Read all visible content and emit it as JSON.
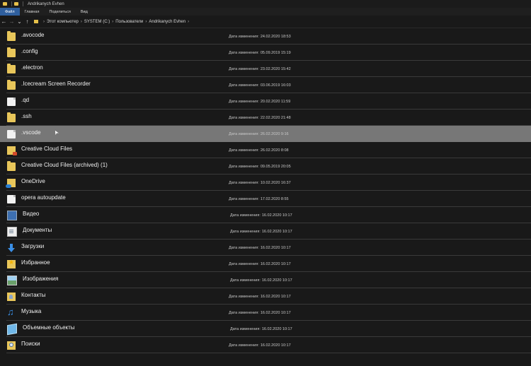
{
  "window": {
    "title": "Andrikanych Evhen"
  },
  "ribbon": {
    "tabs": [
      "Файл",
      "Главная",
      "Поделиться",
      "Вид"
    ],
    "active_tab": "Файл"
  },
  "nav": {
    "back": "←",
    "forward": "→",
    "dropdown": "⌄",
    "up": "↑"
  },
  "breadcrumb": [
    "Этот компьютер",
    "SYSTEM (C:)",
    "Пользователи",
    "Andrikanych Evhen"
  ],
  "date_label": "Дата изменения:",
  "files": [
    {
      "name": ".avocode",
      "date": "24.02.2020 18:53",
      "icon": "folder-icon"
    },
    {
      "name": ".config",
      "date": "05.09.2019 15:19",
      "icon": "folder-icon"
    },
    {
      "name": ".electron",
      "date": "23.02.2020 15:42",
      "icon": "folder-icon"
    },
    {
      "name": ".Icecream Screen Recorder",
      "date": "03.06.2019 16:03",
      "icon": "folder-icon"
    },
    {
      "name": ".qd",
      "date": "20.02.2020 11:59",
      "icon": "document-icon"
    },
    {
      "name": ".ssh",
      "date": "22.02.2020 21:48",
      "icon": "folder-icon"
    },
    {
      "name": ".vscode",
      "date": "26.02.2020 9:16",
      "icon": "document-icon"
    },
    {
      "name": "Creative Cloud Files",
      "date": "26.02.2020 8:08",
      "icon": "creative-cloud-folder-icon"
    },
    {
      "name": "Creative Cloud Files (archived) (1)",
      "date": "09.05.2019 20:05",
      "icon": "folder-icon"
    },
    {
      "name": "OneDrive",
      "date": "10.02.2020 16:37",
      "icon": "onedrive-folder-icon"
    },
    {
      "name": "opera autoupdate",
      "date": "17.02.2020 8:55",
      "icon": "document-icon"
    },
    {
      "name": "Видео",
      "date": "16.02.2020 10:17",
      "icon": "video-folder-icon"
    },
    {
      "name": "Документы",
      "date": "16.02.2020 10:17",
      "icon": "documents-folder-icon"
    },
    {
      "name": "Загрузки",
      "date": "16.02.2020 10:17",
      "icon": "downloads-arrow-icon"
    },
    {
      "name": "Избранное",
      "date": "16.02.2020 10:17",
      "icon": "favorites-star-icon"
    },
    {
      "name": "Изображения",
      "date": "16.02.2020 10:17",
      "icon": "pictures-folder-icon"
    },
    {
      "name": "Контакты",
      "date": "16.02.2020 10:17",
      "icon": "contacts-folder-icon"
    },
    {
      "name": "Музыка",
      "date": "16.02.2020 10:17",
      "icon": "music-note-icon"
    },
    {
      "name": "Объемные объекты",
      "date": "16.02.2020 10:17",
      "icon": "3d-objects-icon"
    },
    {
      "name": "Поиски",
      "date": "16.02.2020 10:17",
      "icon": "searches-folder-icon"
    }
  ],
  "selected_file": ".vscode",
  "colors": {
    "selection": "#777777",
    "folder": "#e8c65a",
    "ribbon_active": "#2f5f9e",
    "background": "#191919"
  }
}
